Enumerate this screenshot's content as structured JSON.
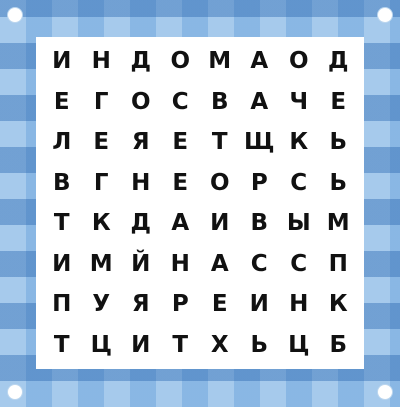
{
  "puzzle": {
    "grid": [
      [
        "И",
        "Н",
        "Д",
        "О",
        "М",
        "А",
        "О",
        "Д"
      ],
      [
        "Е",
        "Г",
        "О",
        "С",
        "В",
        "А",
        "Ч",
        "Е"
      ],
      [
        "Л",
        "Е",
        "Я",
        "Е",
        "Т",
        "Щ",
        "К",
        "Ь"
      ],
      [
        "В",
        "Г",
        "Н",
        "Е",
        "О",
        "Р",
        "С",
        "Ь"
      ],
      [
        "Т",
        "К",
        "Д",
        "А",
        "И",
        "В",
        "Ы",
        "М"
      ],
      [
        "И",
        "М",
        "Й",
        "Н",
        "А",
        "С",
        "С",
        "П"
      ],
      [
        "П",
        "У",
        "Я",
        "Р",
        "Е",
        "И",
        "Н",
        "К"
      ],
      [
        "Т",
        "Ц",
        "И",
        "Т",
        "Х",
        "Ь",
        "Ц",
        "Б"
      ]
    ]
  },
  "colors": {
    "frame_light": "#c9e0f5",
    "frame_dark": "#a6cbec",
    "board_bg": "#ffffff",
    "letter": "#111111"
  }
}
